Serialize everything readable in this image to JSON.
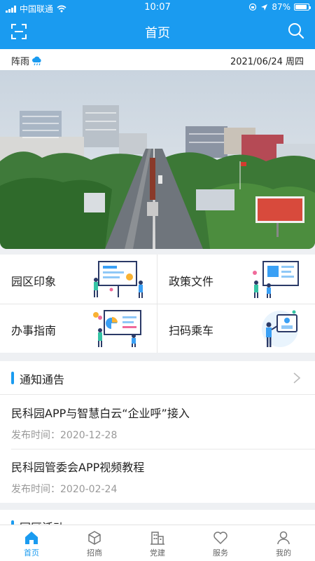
{
  "status_bar": {
    "carrier": "中国联通",
    "time": "10:07",
    "battery_level": "87%",
    "battery_fraction": 0.87
  },
  "nav": {
    "title": "首页",
    "left_icon": "scan-icon",
    "right_icon": "search-icon"
  },
  "info_bar": {
    "weather": "阵雨",
    "weather_icon": "cloud-rain-icon",
    "date": "2021/06/24 周四"
  },
  "quick_links": [
    {
      "label": "园区印象",
      "illustration": "presentation-board-illustration"
    },
    {
      "label": "政策文件",
      "illustration": "document-board-illustration"
    },
    {
      "label": "办事指南",
      "illustration": "chart-board-illustration"
    },
    {
      "label": "扫码乘车",
      "illustration": "person-qr-illustration"
    }
  ],
  "notice": {
    "title": "通知通告",
    "items": [
      {
        "title": "民科园APP与智慧白云“企业呼”接入",
        "date": "发布时间：2020-12-28"
      },
      {
        "title": "民科园管委会APP视频教程",
        "date": "发布时间：2020-02-24"
      }
    ]
  },
  "next_section": {
    "title": "园区活动"
  },
  "tabbar": [
    {
      "label": "首页",
      "icon": "home-icon",
      "active": true
    },
    {
      "label": "招商",
      "icon": "cube-icon",
      "active": false
    },
    {
      "label": "党建",
      "icon": "building-icon",
      "active": false
    },
    {
      "label": "服务",
      "icon": "heart-icon",
      "active": false
    },
    {
      "label": "我的",
      "icon": "user-icon",
      "active": false
    }
  ],
  "colors": {
    "primary": "#1a9bf0",
    "background": "#eef0f3"
  }
}
